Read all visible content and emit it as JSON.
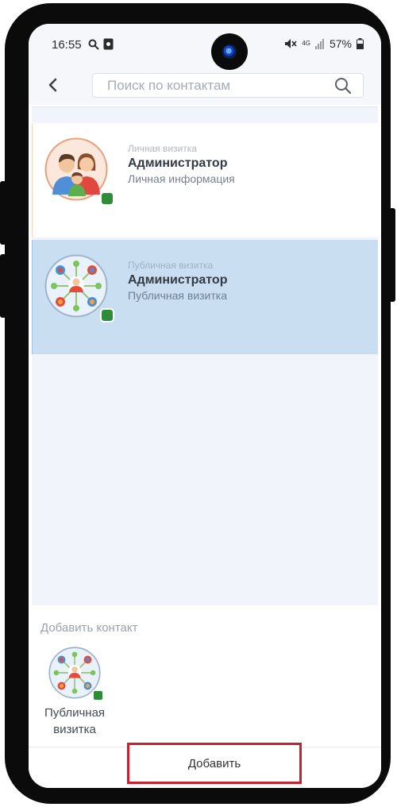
{
  "status_bar": {
    "time": "16:55",
    "network": "4G",
    "battery": "57%",
    "icons": [
      "search-icon",
      "notification-app-icon",
      "mute-icon",
      "signal-icon",
      "battery-icon"
    ]
  },
  "search": {
    "placeholder": "Поиск по контактам",
    "value": "",
    "back_icon": "chevron-left-icon",
    "search_icon": "search-icon"
  },
  "contacts": [
    {
      "type": "Личная визитка",
      "name": "Администратор",
      "subtitle": "Личная информация",
      "avatar_icon": "family-avatar-icon",
      "selected": false
    },
    {
      "type": "Публичная визитка",
      "name": "Администратор",
      "subtitle": "Публичная визитка",
      "avatar_icon": "network-avatar-icon",
      "selected": true
    }
  ],
  "add_contact": {
    "title": "Добавить контакт",
    "items": [
      {
        "label": "Публичная\nвизитка",
        "icon": "network-avatar-icon"
      }
    ]
  },
  "footer": {
    "add_button": "Добавить"
  },
  "colors": {
    "selected_card": "#c9dff1",
    "badge": "#2e8b3a",
    "highlight_border": "#c8212e"
  }
}
